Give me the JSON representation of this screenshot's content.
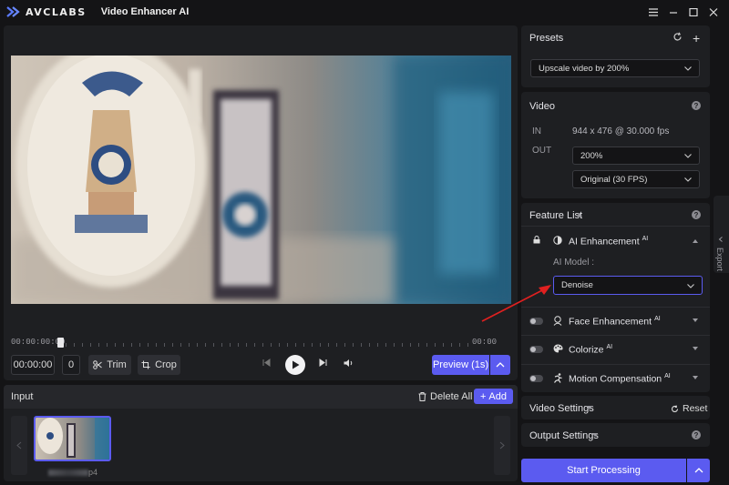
{
  "app": {
    "brand": "AVCLABS",
    "title": "Video Enhancer AI",
    "accent": "#5b5bf0"
  },
  "window_controls": [
    "menu-icon",
    "minimize-icon",
    "maximize-icon",
    "close-icon"
  ],
  "player": {
    "time_start": "00:00:00:00",
    "time_end": "00:00",
    "timecode": "00:00:00",
    "frame": "0",
    "trim_label": "Trim",
    "crop_label": "Crop",
    "preview_label": "Preview (1s)"
  },
  "input": {
    "title": "Input",
    "delete_all": "Delete All",
    "add": "Add",
    "file_ext": "p4"
  },
  "presets": {
    "title": "Presets",
    "selected": "Upscale video by 200%"
  },
  "video": {
    "title": "Video",
    "in_label": "IN",
    "in_value": "944 x 476 @ 30.000 fps",
    "out_label": "OUT",
    "scale": "200%",
    "framerate": "Original (30 FPS)"
  },
  "feature_list": {
    "title": "Feature List",
    "ai_enhancement": "AI Enhancement",
    "ai_sup": "AI",
    "ai_model_label": "AI Model :",
    "ai_model_value": "Denoise",
    "face_enhancement": "Face Enhancement",
    "colorize": "Colorize",
    "motion_compensation": "Motion Compensation"
  },
  "video_settings": {
    "title": "Video Settings",
    "reset": "Reset"
  },
  "output_settings": {
    "title": "Output Settings"
  },
  "start_processing": "Start Processing",
  "export_tab": "Export"
}
